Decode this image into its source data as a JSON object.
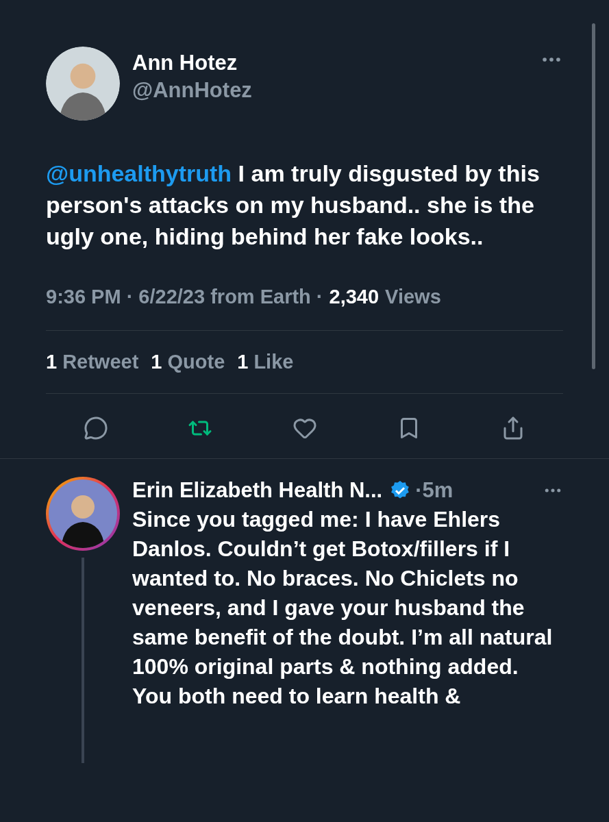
{
  "tweet": {
    "author": {
      "name": "Ann Hotez",
      "handle": "@AnnHotez"
    },
    "mention": "@unhealthytruth",
    "text": "I am truly disgusted by this person's attacks on my husband.. she is the ugly one, hiding behind her fake looks..",
    "meta": "9:36 PM · 6/22/23 from Earth ·",
    "views_count": "2,340",
    "views_label": "Views",
    "stats": [
      {
        "count": "1",
        "label": "Retweet"
      },
      {
        "count": "1",
        "label": "Quote"
      },
      {
        "count": "1",
        "label": "Like"
      }
    ],
    "actions": [
      {
        "kind": "reply",
        "active": false
      },
      {
        "kind": "retweet",
        "active": true
      },
      {
        "kind": "like",
        "active": false
      },
      {
        "kind": "bookmark",
        "active": false
      },
      {
        "kind": "share",
        "active": false
      }
    ]
  },
  "reply": {
    "name": "Erin Elizabeth Health N...",
    "verified": true,
    "time": "·5m",
    "text": "Since you tagged me: I have Ehlers Danlos. Couldn’t get Botox/fillers if I wanted to. No braces. No Chiclets no veneers, and I gave your husband the same benefit of the doubt. I’m all natural 100% original parts &  nothing added. You both need to learn health &"
  }
}
